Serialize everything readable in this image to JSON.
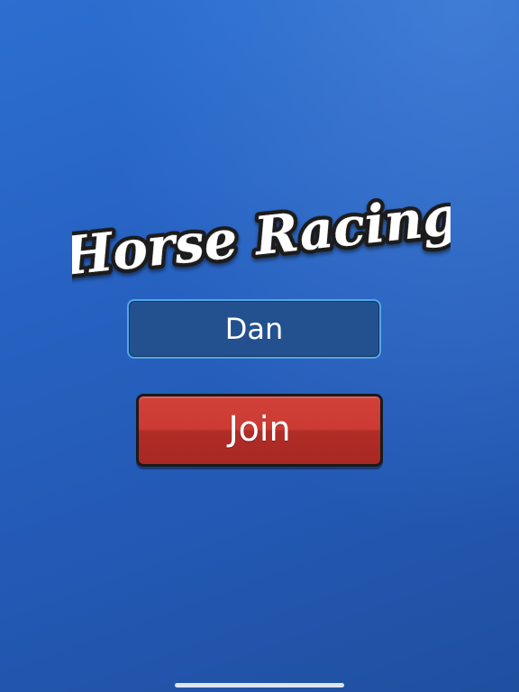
{
  "game": {
    "title": "Horse Racing"
  },
  "name_field": {
    "value": "Dan"
  },
  "join_button": {
    "label": "Join"
  },
  "colors": {
    "background": "#2762c2",
    "field_bg": "#23508f",
    "field_border": "#4fa8e8",
    "button_red": "#cc3a34",
    "logo_text": "#ffffff",
    "logo_outline": "#1a1a1a"
  }
}
